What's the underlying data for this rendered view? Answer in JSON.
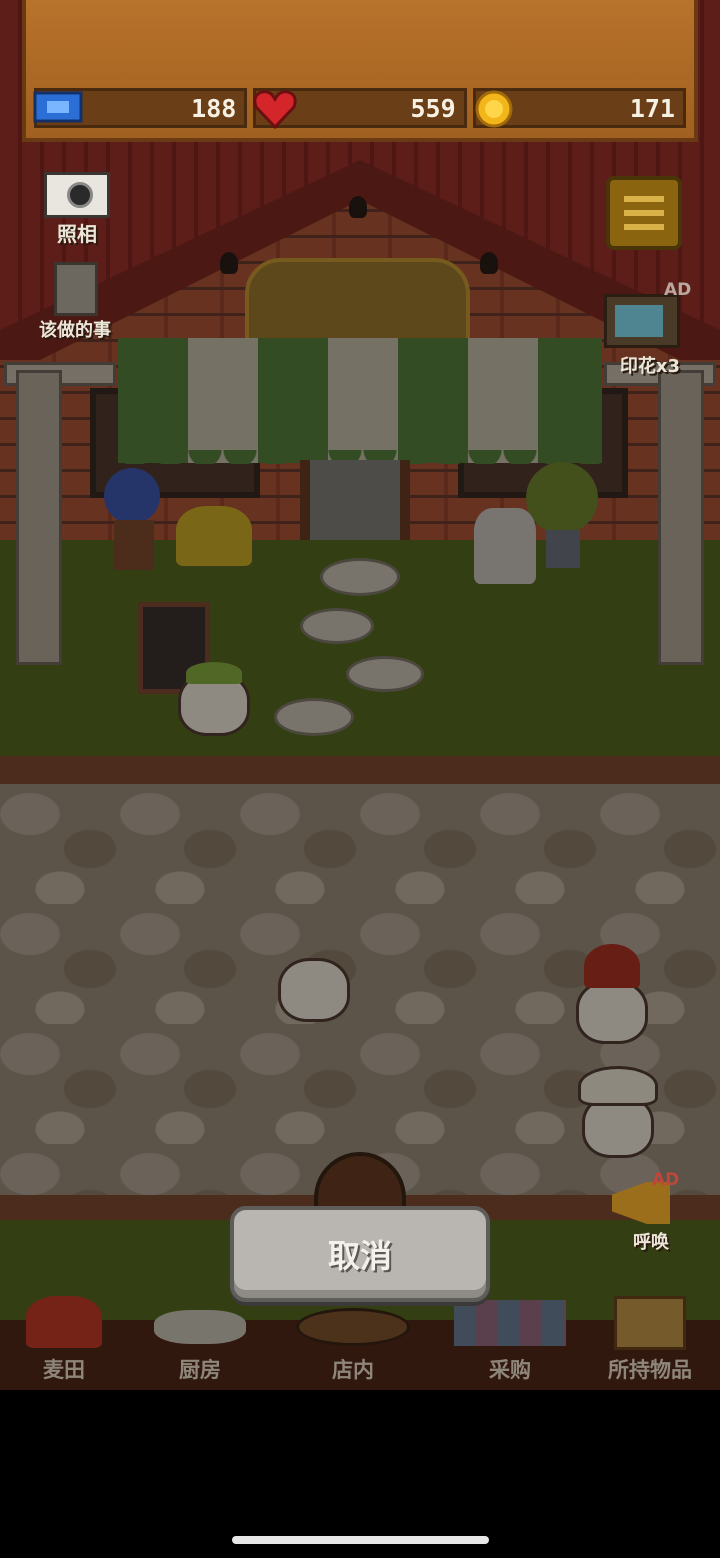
{
  "stats": {
    "tickets": "188",
    "hearts": "559",
    "coins": "171"
  },
  "left_controls": {
    "camera_label": "照相",
    "todo_label": "该做的事"
  },
  "right_controls": {
    "stamp_label": "印花x3",
    "stamp_ad_badge": "AD",
    "call_label": "呼唤",
    "call_ad_badge": "AD"
  },
  "cancel": {
    "label": "取消"
  },
  "nav": {
    "items": [
      {
        "label": "麦田",
        "icon": "wheat-field-icon"
      },
      {
        "label": "厨房",
        "icon": "kitchen-icon"
      },
      {
        "label": "店内",
        "icon": "store-interior-icon"
      },
      {
        "label": "采购",
        "icon": "purchase-icon"
      },
      {
        "label": "所持物品",
        "icon": "inventory-box-icon"
      }
    ]
  },
  "colors": {
    "wood": "#b8732c",
    "stat_bg": "#6a3e17",
    "grass": "#3d4a16",
    "roof": "#6e231d",
    "cancel_bg": "#b9b6b1"
  }
}
